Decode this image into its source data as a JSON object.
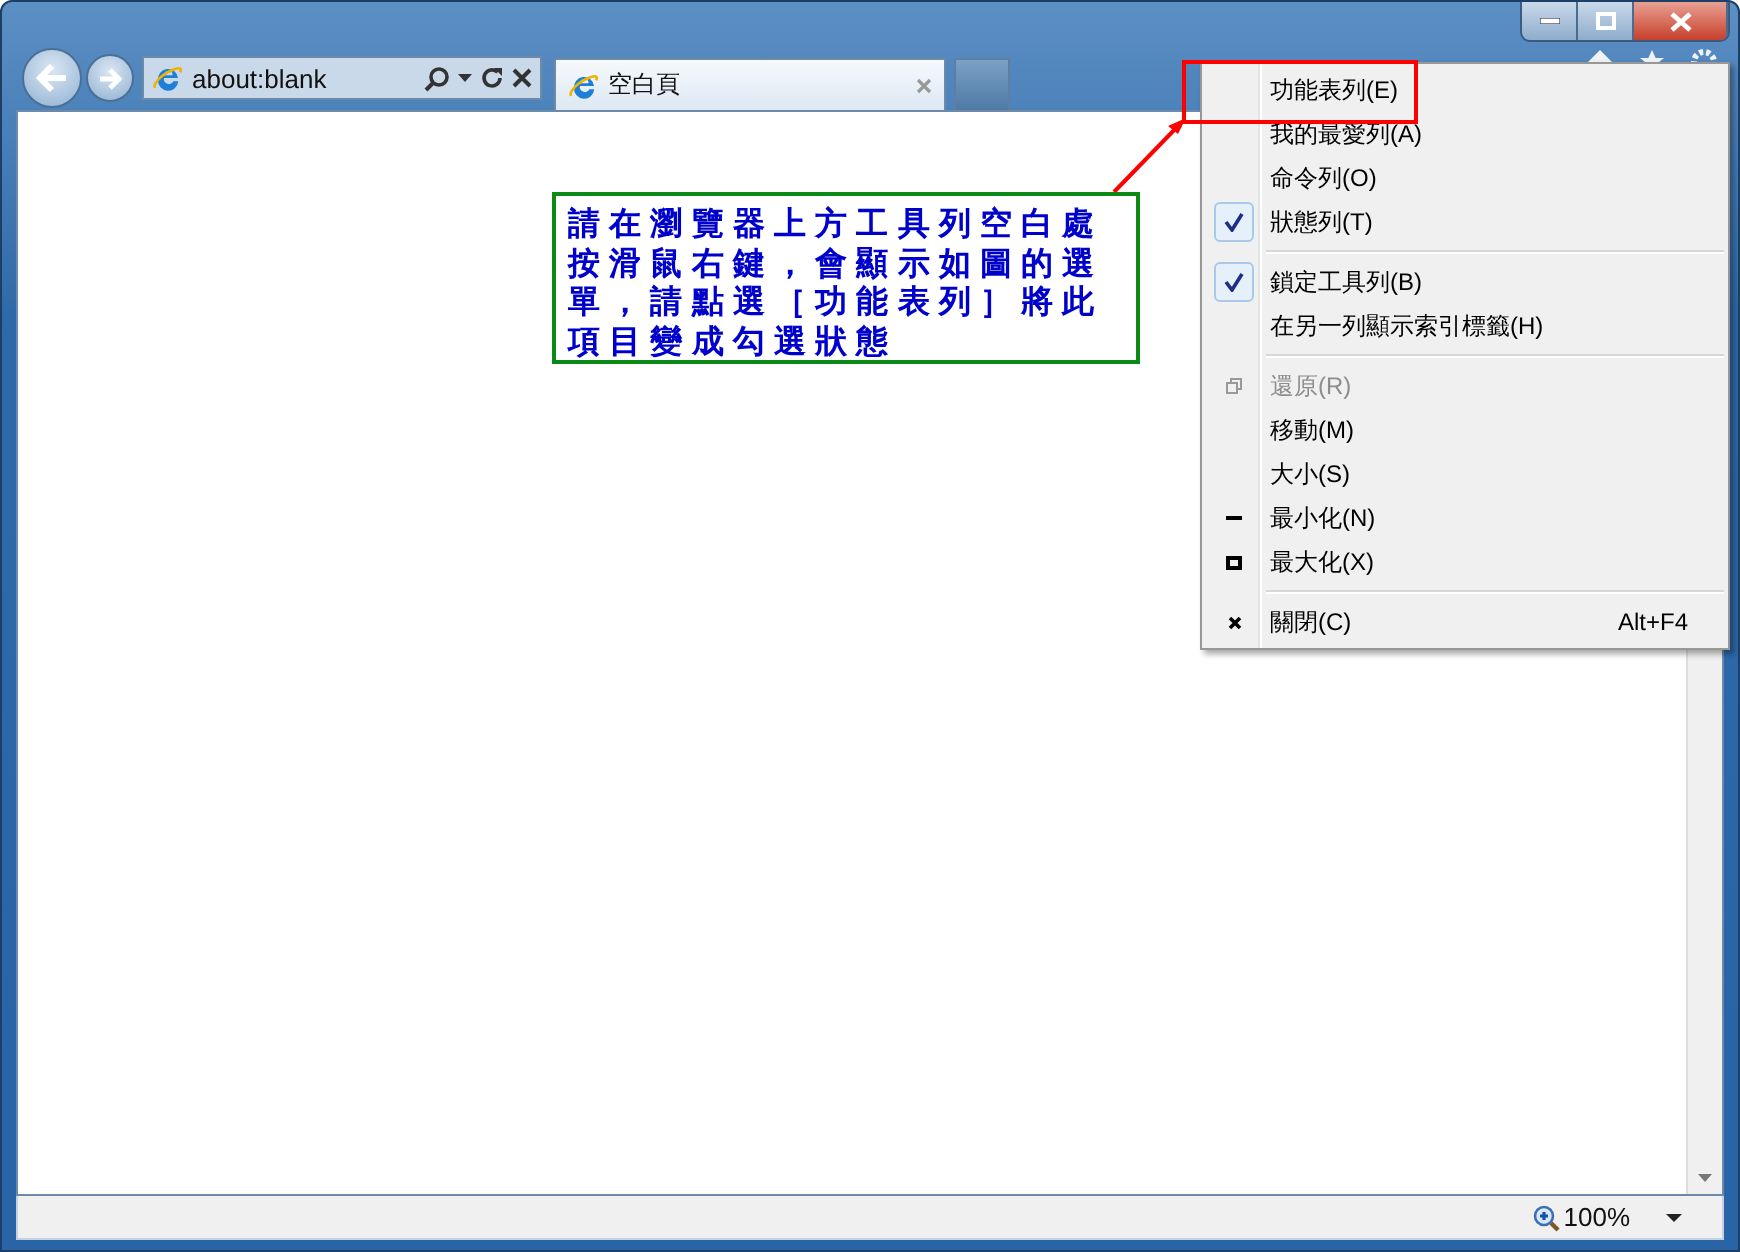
{
  "address_bar": {
    "url": "about:blank"
  },
  "tabs": [
    {
      "title": "空白頁",
      "selected": true
    }
  ],
  "context_menu": {
    "items": [
      {
        "kind": "item",
        "label": "功能表列(E)",
        "checked": false,
        "disabled": false,
        "highlighted": true
      },
      {
        "kind": "item",
        "label": "我的最愛列(A)",
        "checked": false,
        "disabled": false
      },
      {
        "kind": "item",
        "label": "命令列(O)",
        "checked": false,
        "disabled": false
      },
      {
        "kind": "item",
        "label": "狀態列(T)",
        "checked": true,
        "disabled": false
      },
      {
        "kind": "separator"
      },
      {
        "kind": "item",
        "label": "鎖定工具列(B)",
        "checked": true,
        "disabled": false
      },
      {
        "kind": "item",
        "label": "在另一列顯示索引標籤(H)",
        "checked": false,
        "disabled": false
      },
      {
        "kind": "separator"
      },
      {
        "kind": "restore",
        "label": "還原(R)",
        "disabled": true
      },
      {
        "kind": "item",
        "label": "移動(M)",
        "disabled": false
      },
      {
        "kind": "item",
        "label": "大小(S)",
        "disabled": false
      },
      {
        "kind": "minimize",
        "label": "最小化(N)",
        "disabled": false
      },
      {
        "kind": "maximize",
        "label": "最大化(X)",
        "disabled": false
      },
      {
        "kind": "separator"
      },
      {
        "kind": "close",
        "label": "關閉(C)",
        "shortcut": "Alt+F4",
        "disabled": false
      }
    ]
  },
  "annotation": {
    "text": "請在瀏覽器上方工具列空白處按滑鼠右鍵，會顯示如圖的選單，請點選［功能表列］將此項目變成勾選狀態"
  },
  "status_bar": {
    "zoom": "100%"
  }
}
